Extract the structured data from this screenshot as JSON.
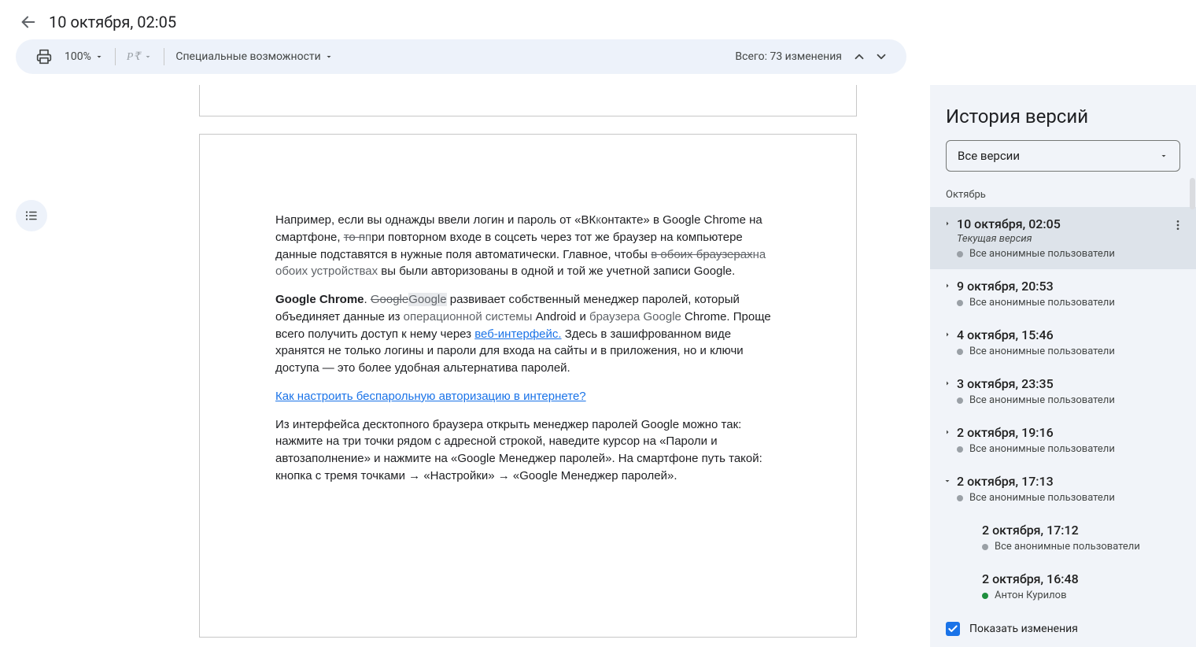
{
  "header": {
    "title": "10 октября, 02:05"
  },
  "toolbar": {
    "zoom": "100%",
    "mode_icon_label": "P₹",
    "accessibility": "Специальные возможности",
    "changes_total": "Всего: 73 изменения"
  },
  "document": {
    "p1_a": "Например, если вы однажды ввели логин и пароль от «ВК",
    "p1_a_ins": "к",
    "p1_a2": "онтакте» в Google Chrome на смартфоне, ",
    "p1_del1": "то п",
    "p1_ins1": "п",
    "p1_b": "ри повторном входе в соцсеть через тот же браузер на компьютере данные подставятся в нужные поля автоматически. Главное, чтобы ",
    "p1_del2": "в обоих браузерах",
    "p1_ins2": "на обоих устройствах",
    "p1_c": " вы были авторизованы в одной и той же учетной записи Google.",
    "p2_bold": "Google Chrome",
    "p2_dot": ". ",
    "p2_del": "Google",
    "p2_ins": "Google",
    "p2_a": " развивает собственный менеджер паролей, который объединяет данные из ",
    "p2_ins_b": "операционной системы",
    "p2_b": " Android и ",
    "p2_ins_c": "браузера Google",
    "p2_c": " Chrome. Проще всего получить доступ к нему через ",
    "p2_link": "веб-интерфейс.",
    "p2_d": " Здесь в зашифрованном виде хранятся не только логины и пароли для входа на сайты и в приложения, но и ключи доступа — это более удобная альтернатива паролей.",
    "p3_link": "Как настроить беспарольную авторизацию в интернете?",
    "p4": "Из интерфейса десктопного браузера открыть менеджер паролей Google можно так: нажмите на три точки рядом с адресной строкой, наведите курсор на «Пароли и автозаполнение» и нажмите на «Google Менеджер паролей». На смартфоне путь такой: кнопка с тремя точками → «Настройки» → «Google Менеджер паролей»."
  },
  "panel": {
    "title": "История версий",
    "filter": "Все версии",
    "month": "Октябрь",
    "show_changes": "Показать изменения",
    "versions": [
      {
        "date": "10 октября, 02:05",
        "subtitle": "Текущая версия",
        "author": "Все анонимные пользователи",
        "selected": true,
        "expandable": true,
        "expanded": false,
        "kebab": true,
        "dot": "grey"
      },
      {
        "date": "9 октября, 20:53",
        "subtitle": "",
        "author": "Все анонимные пользователи",
        "selected": false,
        "expandable": true,
        "expanded": false,
        "kebab": false,
        "dot": "grey"
      },
      {
        "date": "4 октября, 15:46",
        "subtitle": "",
        "author": "Все анонимные пользователи",
        "selected": false,
        "expandable": true,
        "expanded": false,
        "kebab": false,
        "dot": "grey"
      },
      {
        "date": "3 октября, 23:35",
        "subtitle": "",
        "author": "Все анонимные пользователи",
        "selected": false,
        "expandable": true,
        "expanded": false,
        "kebab": false,
        "dot": "grey"
      },
      {
        "date": "2 октября, 19:16",
        "subtitle": "",
        "author": "Все анонимные пользователи",
        "selected": false,
        "expandable": true,
        "expanded": false,
        "kebab": false,
        "dot": "grey"
      },
      {
        "date": "2 октября, 17:13",
        "subtitle": "",
        "author": "Все анонимные пользователи",
        "selected": false,
        "expandable": true,
        "expanded": true,
        "kebab": false,
        "dot": "grey"
      },
      {
        "date": "2 октября, 17:12",
        "subtitle": "",
        "author": "Все анонимные пользователи",
        "selected": false,
        "expandable": false,
        "expanded": false,
        "kebab": false,
        "dot": "grey",
        "sub": true
      },
      {
        "date": "2 октября, 16:48",
        "subtitle": "",
        "author": "Антон Курилов",
        "selected": false,
        "expandable": false,
        "expanded": false,
        "kebab": false,
        "dot": "green",
        "sub": true
      }
    ]
  }
}
